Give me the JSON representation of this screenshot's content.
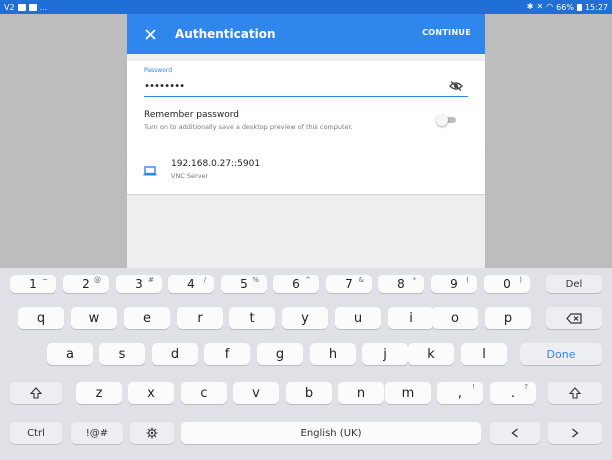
{
  "statusbar": {
    "left_text": "V2",
    "right_text": "66%",
    "time": "15:27",
    "ellipsis": "..."
  },
  "appbar": {
    "title": "Authentication",
    "continue_label": "CONTINUE"
  },
  "password": {
    "label": "Password",
    "value": "••••••••"
  },
  "remember": {
    "title": "Remember password",
    "subtitle": "Turn on to additionally save a desktop preview of this computer."
  },
  "server": {
    "address": "192.168.0.27::5901",
    "type": "VNC Server"
  },
  "keyboard": {
    "numbers": [
      {
        "k": "1",
        "s": "~"
      },
      {
        "k": "2",
        "s": "@"
      },
      {
        "k": "3",
        "s": "#"
      },
      {
        "k": "4",
        "s": "/"
      },
      {
        "k": "5",
        "s": "%"
      },
      {
        "k": "6",
        "s": "^"
      },
      {
        "k": "7",
        "s": "&"
      },
      {
        "k": "8",
        "s": "*"
      },
      {
        "k": "9",
        "s": "("
      },
      {
        "k": "0",
        "s": ")"
      }
    ],
    "del": "Del",
    "row1": [
      "q",
      "w",
      "e",
      "r",
      "t",
      "y",
      "u",
      "i",
      "o",
      "p"
    ],
    "row2": [
      "a",
      "s",
      "d",
      "f",
      "g",
      "h",
      "j",
      "k",
      "l"
    ],
    "row3": [
      "z",
      "x",
      "c",
      "v",
      "b",
      "n",
      "m"
    ],
    "comma": ",",
    "comma_sup": "!",
    "period": ".",
    "period_sup": "?",
    "done": "Done",
    "ctrl": "Ctrl",
    "symbols": "!@#",
    "space": "English (UK)"
  }
}
